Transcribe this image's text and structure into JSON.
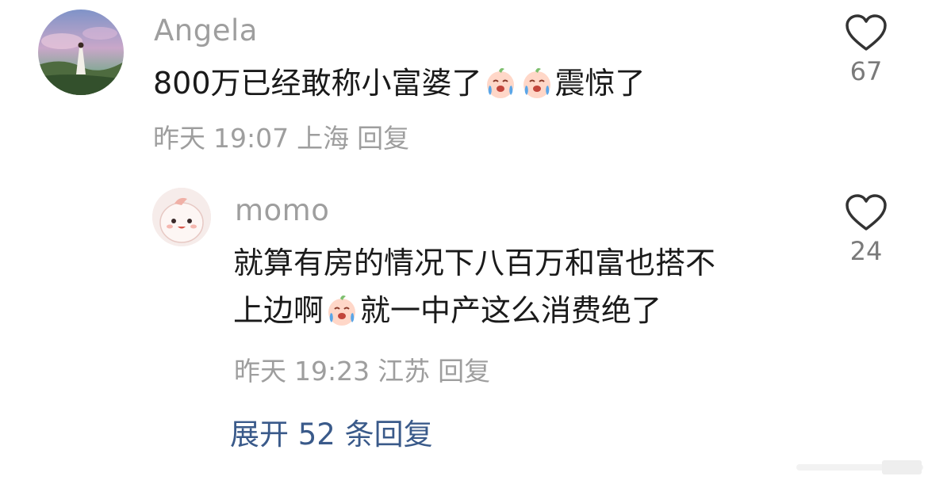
{
  "comments": [
    {
      "username": "Angela",
      "text_parts": [
        "800万已经敢称小富婆了",
        "",
        "",
        "震惊了"
      ],
      "date": "昨天",
      "time": "19:07",
      "location": "上海",
      "reply_label": "回复",
      "likes": "67"
    },
    {
      "username": "momo",
      "line1": "就算有房的情况下八百万和富也搭不",
      "line2_a": "上边啊",
      "line2_b": "就一中产这么消费绝了",
      "date": "昨天",
      "time": "19:23",
      "location": "江苏",
      "reply_label": "回复",
      "likes": "24"
    }
  ],
  "expand_label": "展开 52 条回复",
  "emoji_name": "crying-face-emoji",
  "colors": {
    "username": "#9e9e9e",
    "text": "#1a1a1a",
    "meta": "#9e9e9e",
    "link": "#3a5a8a"
  }
}
